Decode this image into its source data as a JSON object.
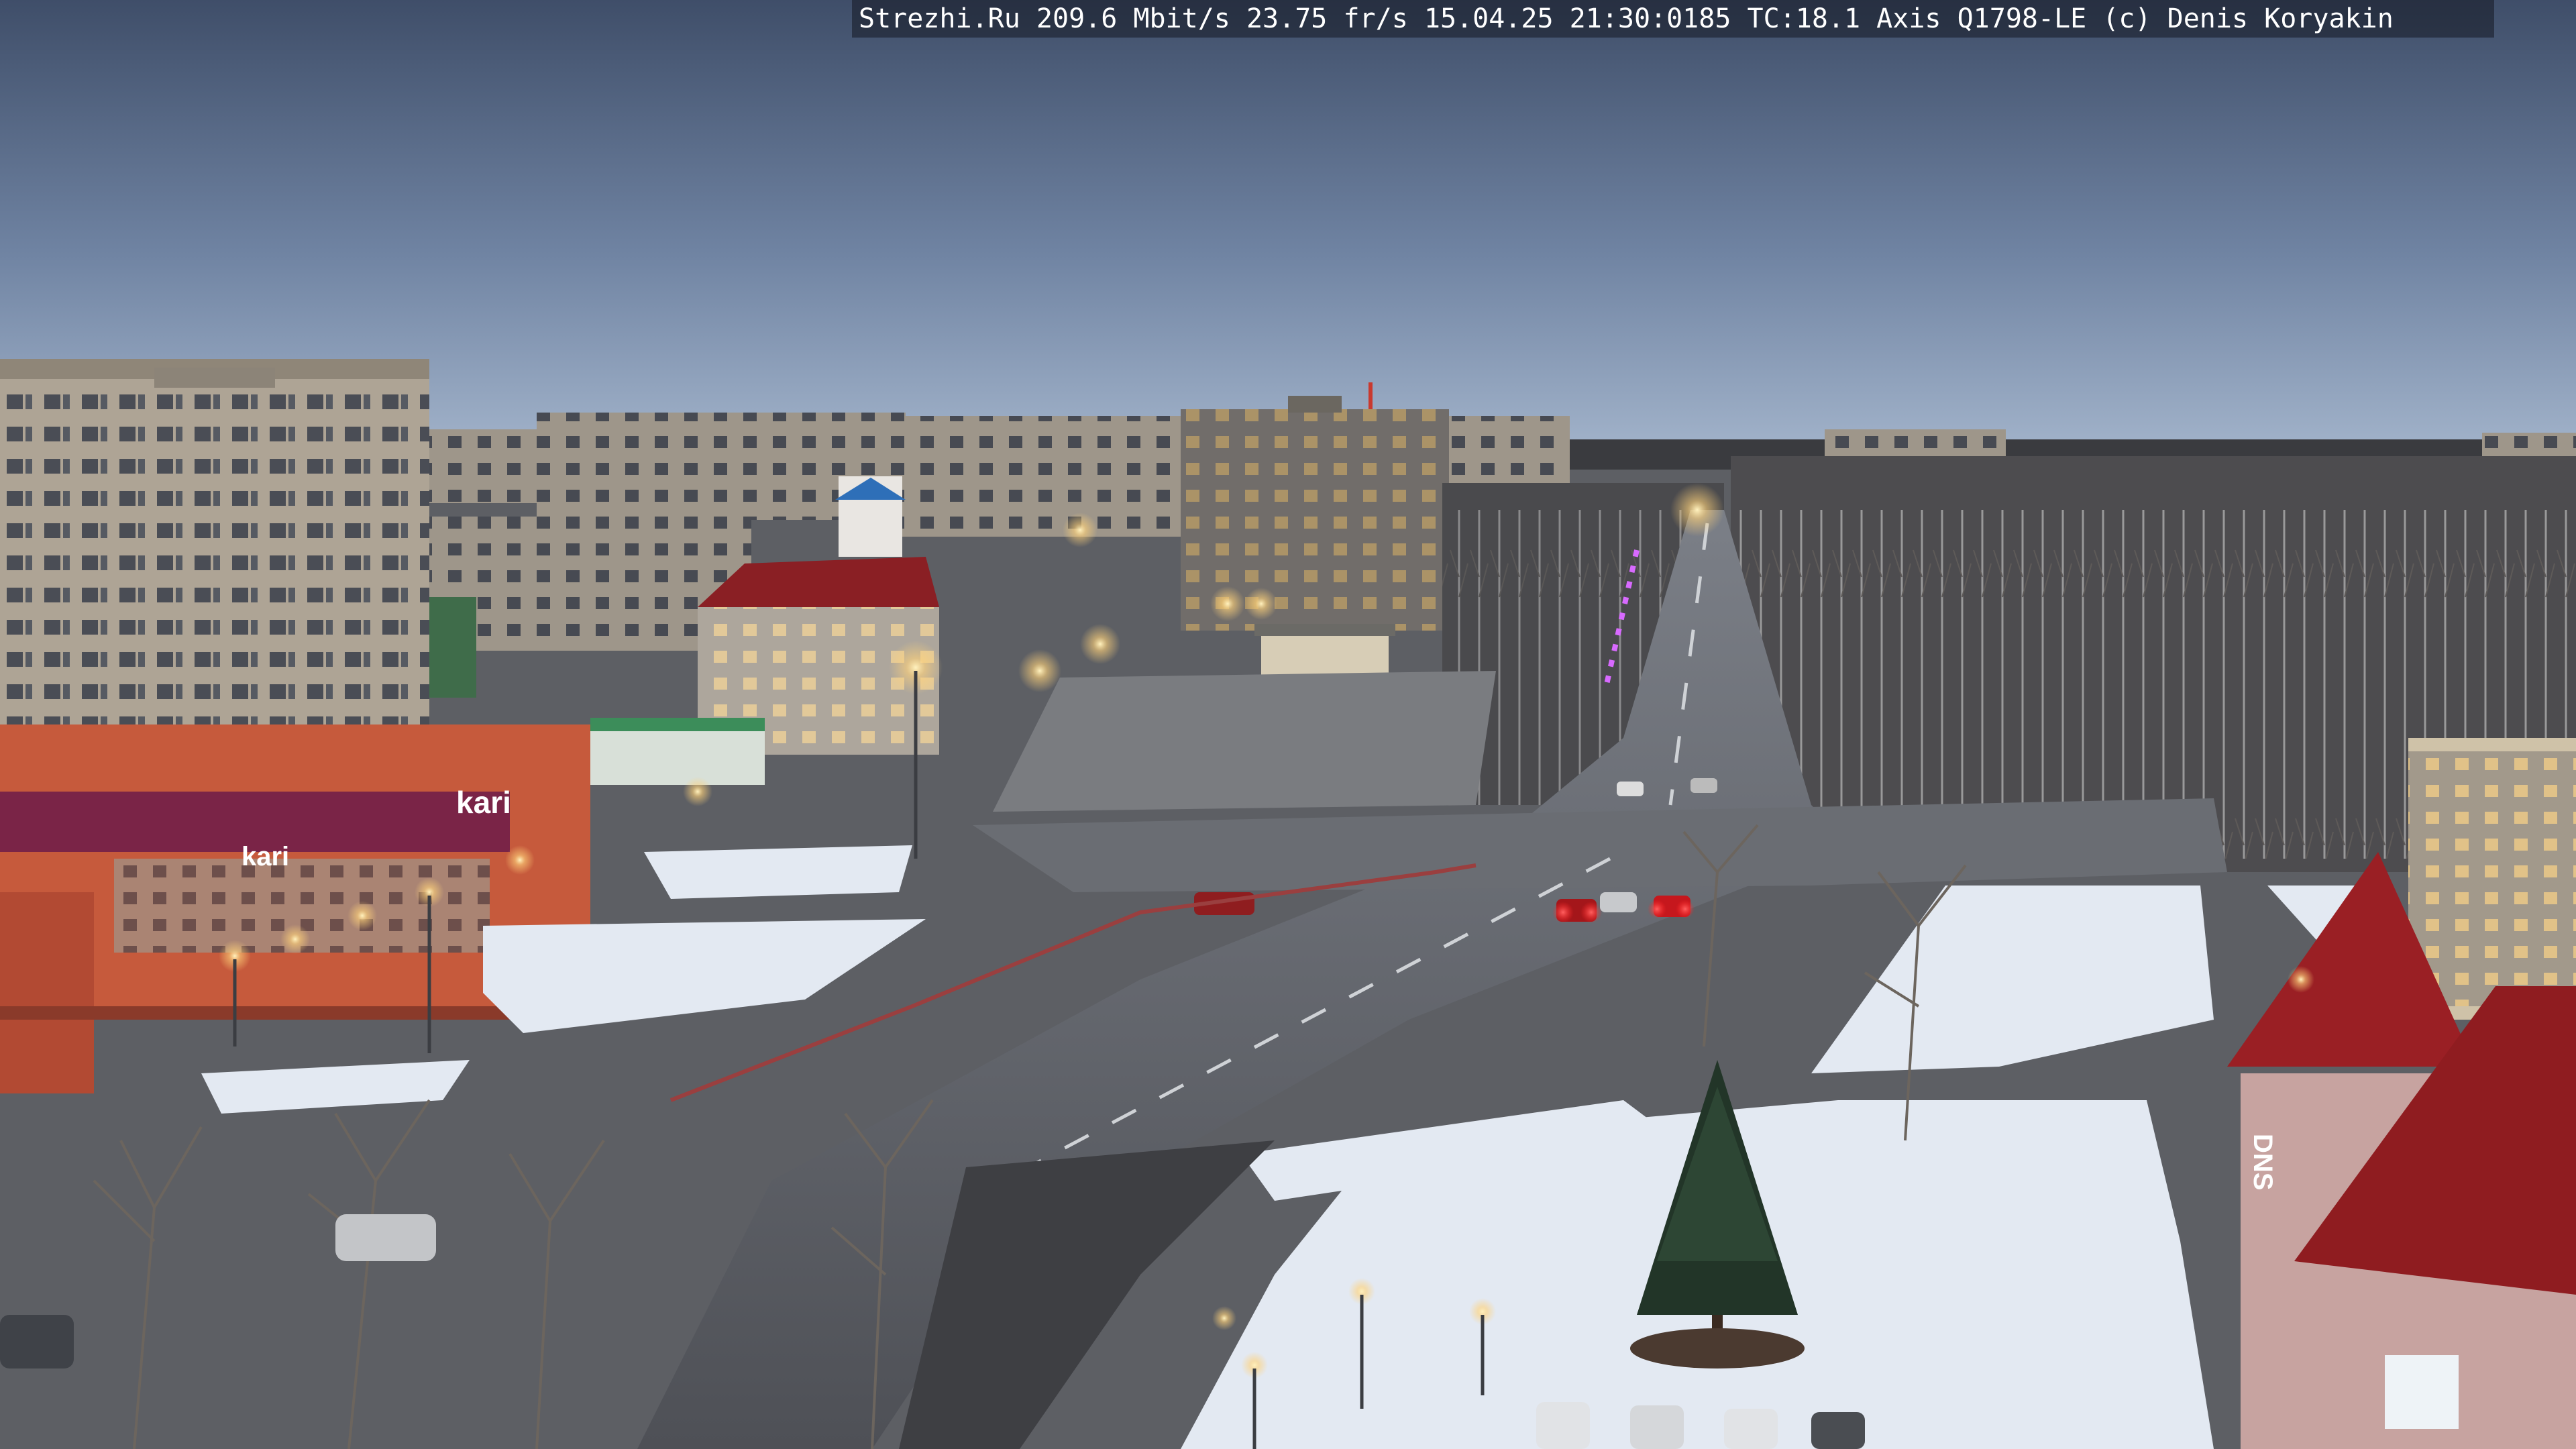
{
  "overlay": {
    "text": "Strezhi.Ru 209.6 Mbit/s 23.75 fr/s 15.04.25 21:30:0185 TC:18.1  Axis Q1798-LE  (c) Denis Koryakin"
  },
  "storefront_signs": {
    "kari_upper": "kari",
    "kari_lower": "kari",
    "dns": "DNS"
  },
  "colors": {
    "sky_top": "#3e4d68",
    "sky_horizon": "#8da3c2",
    "road": "#55575d",
    "snow": "#e6ecf4",
    "building_panel": "#b8ad9f",
    "mall_orange": "#c35a3a",
    "roof_red": "#9a1f1f",
    "light_warm": "#ffd98a",
    "tail_light": "#ff3030"
  }
}
